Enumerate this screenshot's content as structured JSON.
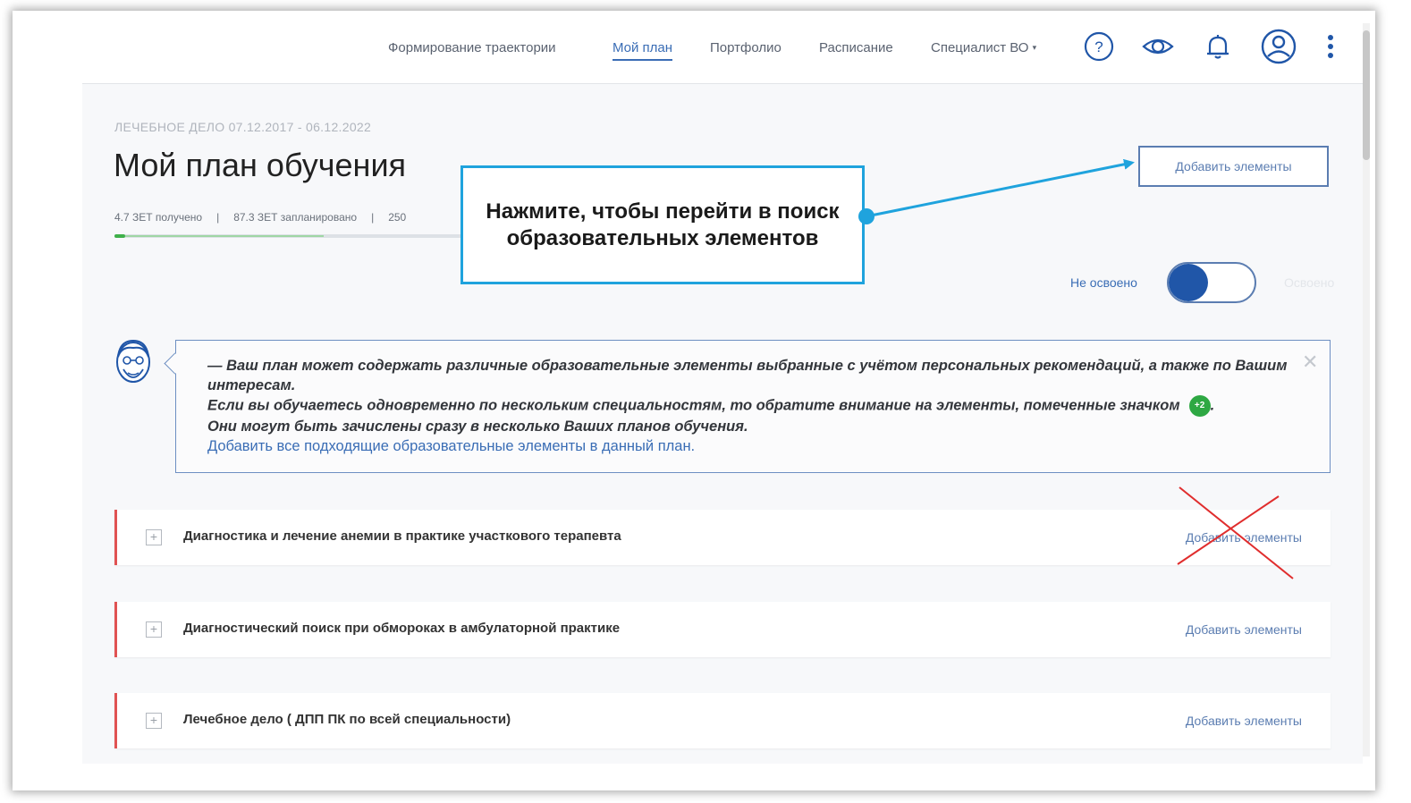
{
  "nav": {
    "items": [
      {
        "label": "Формирование траектории",
        "active": false
      },
      {
        "label": "Мой план",
        "active": true
      },
      {
        "label": "Портфолио",
        "active": false
      },
      {
        "label": "Расписание",
        "active": false
      },
      {
        "label": "Специалист ВО",
        "active": false
      }
    ],
    "icons": [
      "help-icon",
      "eye-icon",
      "bell-icon",
      "user-account-icon",
      "more-vertical-icon"
    ],
    "accent_color": "#3a6db5"
  },
  "page": {
    "breadcrumb": "ЛЕЧЕБНОЕ ДЕЛО 07.12.2017 - 06.12.2022",
    "title": "Мой план обучения",
    "stats": {
      "received": "4.7 ЗЕТ получено",
      "planned": "87.3 ЗЕТ запланировано",
      "more": "250"
    },
    "progress_received_fraction": 0.03,
    "progress_planned_fraction": 0.6,
    "add_elements_button": "Добавить элементы",
    "toggle": {
      "left_label": "Не освоено",
      "right_label": "Освоено",
      "state": "Не освоено"
    }
  },
  "callout": {
    "text": "Нажмите, чтобы перейти в поиск образовательных элементов",
    "border_color": "#1fa3dd"
  },
  "info": {
    "line1": "— Ваш план может содержать различные образовательные элементы выбранные с учётом персональных рекомендаций, а также по Вашим интересам.",
    "line2": "Если вы обучаетесь одновременно по нескольким специальностям, то обратите внимание на элементы, помеченные значком",
    "badge": "+2",
    "line3": "Они могут быть зачислены сразу в несколько Ваших планов обучения.",
    "link": "Добавить все подходящие образовательные элементы в данный план."
  },
  "rows": [
    {
      "title": "Диагностика и лечение анемии в практике участкового терапевта",
      "action": "Добавить элементы",
      "crossed_out": true
    },
    {
      "title": "Диагностический поиск при обмороках в амбулаторной практике",
      "action": "Добавить элементы",
      "crossed_out": false
    },
    {
      "title": "Лечебное дело ( ДПП ПК по всей специальности)",
      "action": "Добавить элементы",
      "crossed_out": false
    }
  ],
  "status_colors": {
    "row_marker": "#e05252",
    "badge": "#2ea843",
    "cross": "#e02d2d"
  }
}
